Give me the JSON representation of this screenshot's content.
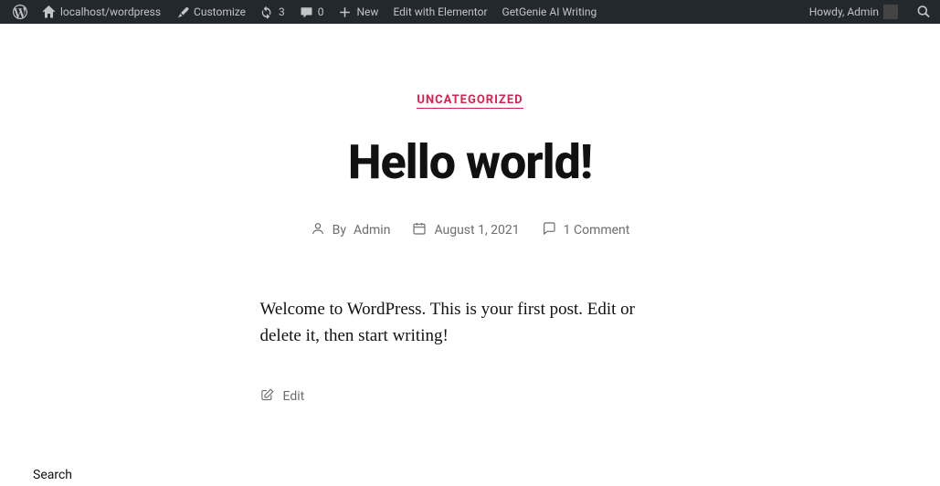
{
  "adminBar": {
    "siteName": "localhost/wordpress",
    "customize": "Customize",
    "updatesCount": "3",
    "commentsCount": "0",
    "newLabel": "New",
    "editElementor": "Edit with Elementor",
    "getGenie": "GetGenie AI Writing",
    "howdy": "Howdy, Admin"
  },
  "post": {
    "category": "UNCATEGORIZED",
    "title": "Hello world!",
    "byPrefix": "By",
    "author": "Admin",
    "date": "August 1, 2021",
    "commentsLabel": "1 Comment",
    "body": "Welcome to WordPress. This is your first post. Edit or delete it, then start writing!",
    "editLabel": "Edit"
  },
  "widget": {
    "searchLabel": "Search"
  }
}
